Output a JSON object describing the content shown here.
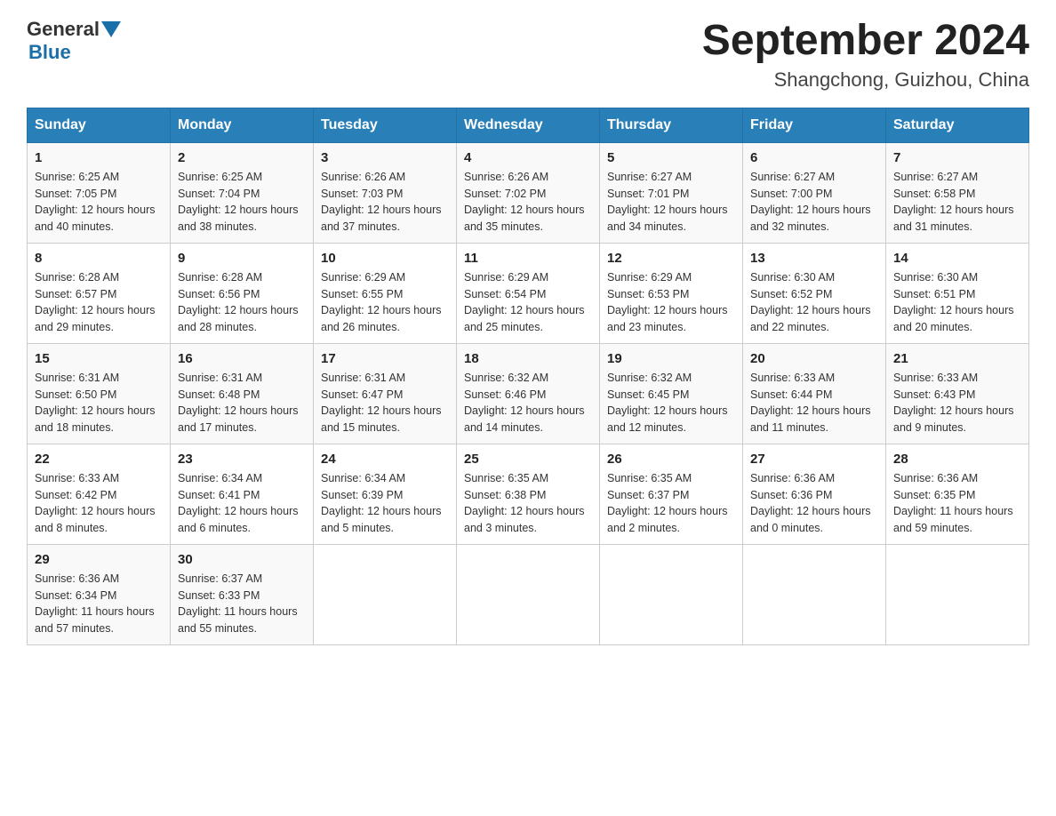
{
  "header": {
    "logo_general": "General",
    "logo_blue": "Blue",
    "month_year": "September 2024",
    "location": "Shangchong, Guizhou, China"
  },
  "days_of_week": [
    "Sunday",
    "Monday",
    "Tuesday",
    "Wednesday",
    "Thursday",
    "Friday",
    "Saturday"
  ],
  "weeks": [
    [
      {
        "day": "1",
        "sunrise": "6:25 AM",
        "sunset": "7:05 PM",
        "daylight": "12 hours and 40 minutes."
      },
      {
        "day": "2",
        "sunrise": "6:25 AM",
        "sunset": "7:04 PM",
        "daylight": "12 hours and 38 minutes."
      },
      {
        "day": "3",
        "sunrise": "6:26 AM",
        "sunset": "7:03 PM",
        "daylight": "12 hours and 37 minutes."
      },
      {
        "day": "4",
        "sunrise": "6:26 AM",
        "sunset": "7:02 PM",
        "daylight": "12 hours and 35 minutes."
      },
      {
        "day": "5",
        "sunrise": "6:27 AM",
        "sunset": "7:01 PM",
        "daylight": "12 hours and 34 minutes."
      },
      {
        "day": "6",
        "sunrise": "6:27 AM",
        "sunset": "7:00 PM",
        "daylight": "12 hours and 32 minutes."
      },
      {
        "day": "7",
        "sunrise": "6:27 AM",
        "sunset": "6:58 PM",
        "daylight": "12 hours and 31 minutes."
      }
    ],
    [
      {
        "day": "8",
        "sunrise": "6:28 AM",
        "sunset": "6:57 PM",
        "daylight": "12 hours and 29 minutes."
      },
      {
        "day": "9",
        "sunrise": "6:28 AM",
        "sunset": "6:56 PM",
        "daylight": "12 hours and 28 minutes."
      },
      {
        "day": "10",
        "sunrise": "6:29 AM",
        "sunset": "6:55 PM",
        "daylight": "12 hours and 26 minutes."
      },
      {
        "day": "11",
        "sunrise": "6:29 AM",
        "sunset": "6:54 PM",
        "daylight": "12 hours and 25 minutes."
      },
      {
        "day": "12",
        "sunrise": "6:29 AM",
        "sunset": "6:53 PM",
        "daylight": "12 hours and 23 minutes."
      },
      {
        "day": "13",
        "sunrise": "6:30 AM",
        "sunset": "6:52 PM",
        "daylight": "12 hours and 22 minutes."
      },
      {
        "day": "14",
        "sunrise": "6:30 AM",
        "sunset": "6:51 PM",
        "daylight": "12 hours and 20 minutes."
      }
    ],
    [
      {
        "day": "15",
        "sunrise": "6:31 AM",
        "sunset": "6:50 PM",
        "daylight": "12 hours and 18 minutes."
      },
      {
        "day": "16",
        "sunrise": "6:31 AM",
        "sunset": "6:48 PM",
        "daylight": "12 hours and 17 minutes."
      },
      {
        "day": "17",
        "sunrise": "6:31 AM",
        "sunset": "6:47 PM",
        "daylight": "12 hours and 15 minutes."
      },
      {
        "day": "18",
        "sunrise": "6:32 AM",
        "sunset": "6:46 PM",
        "daylight": "12 hours and 14 minutes."
      },
      {
        "day": "19",
        "sunrise": "6:32 AM",
        "sunset": "6:45 PM",
        "daylight": "12 hours and 12 minutes."
      },
      {
        "day": "20",
        "sunrise": "6:33 AM",
        "sunset": "6:44 PM",
        "daylight": "12 hours and 11 minutes."
      },
      {
        "day": "21",
        "sunrise": "6:33 AM",
        "sunset": "6:43 PM",
        "daylight": "12 hours and 9 minutes."
      }
    ],
    [
      {
        "day": "22",
        "sunrise": "6:33 AM",
        "sunset": "6:42 PM",
        "daylight": "12 hours and 8 minutes."
      },
      {
        "day": "23",
        "sunrise": "6:34 AM",
        "sunset": "6:41 PM",
        "daylight": "12 hours and 6 minutes."
      },
      {
        "day": "24",
        "sunrise": "6:34 AM",
        "sunset": "6:39 PM",
        "daylight": "12 hours and 5 minutes."
      },
      {
        "day": "25",
        "sunrise": "6:35 AM",
        "sunset": "6:38 PM",
        "daylight": "12 hours and 3 minutes."
      },
      {
        "day": "26",
        "sunrise": "6:35 AM",
        "sunset": "6:37 PM",
        "daylight": "12 hours and 2 minutes."
      },
      {
        "day": "27",
        "sunrise": "6:36 AM",
        "sunset": "6:36 PM",
        "daylight": "12 hours and 0 minutes."
      },
      {
        "day": "28",
        "sunrise": "6:36 AM",
        "sunset": "6:35 PM",
        "daylight": "11 hours and 59 minutes."
      }
    ],
    [
      {
        "day": "29",
        "sunrise": "6:36 AM",
        "sunset": "6:34 PM",
        "daylight": "11 hours and 57 minutes."
      },
      {
        "day": "30",
        "sunrise": "6:37 AM",
        "sunset": "6:33 PM",
        "daylight": "11 hours and 55 minutes."
      },
      null,
      null,
      null,
      null,
      null
    ]
  ],
  "labels": {
    "sunrise": "Sunrise:",
    "sunset": "Sunset:",
    "daylight": "Daylight:"
  }
}
